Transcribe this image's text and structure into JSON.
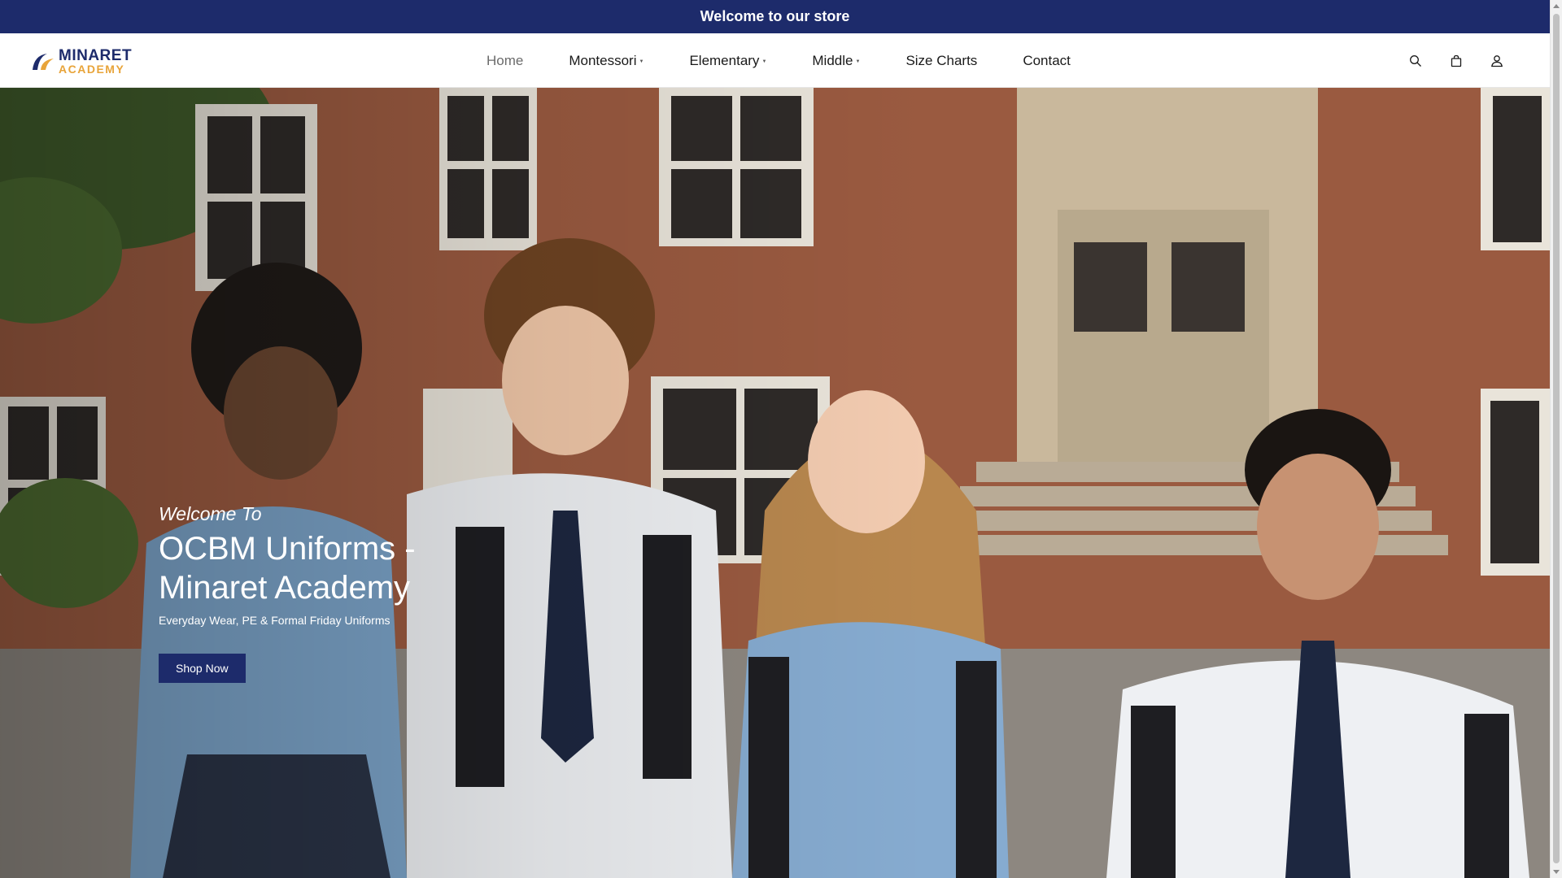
{
  "announcement": {
    "text": "Welcome to our store"
  },
  "header": {
    "logo": {
      "line1": "MINARET",
      "line2": "ACADEMY"
    },
    "nav": [
      {
        "label": "Home",
        "has_dropdown": false,
        "active": true
      },
      {
        "label": "Montessori",
        "has_dropdown": true
      },
      {
        "label": "Elementary",
        "has_dropdown": true
      },
      {
        "label": "Middle",
        "has_dropdown": true
      },
      {
        "label": "Size Charts",
        "has_dropdown": false
      },
      {
        "label": "Contact",
        "has_dropdown": false
      }
    ],
    "icons": [
      "search-icon",
      "cart-icon",
      "account-icon"
    ]
  },
  "hero": {
    "eyebrow": "Welcome To",
    "title": "OCBM Uniforms - Minaret Academy",
    "subtitle": "Everyday Wear, PE & Formal Friday Uniforms",
    "button_label": "Shop Now",
    "image_description": "Four smiling students in school uniforms walking in front of a brick school building"
  },
  "colors": {
    "brand_navy": "#1d2b6b",
    "brand_gold": "#e8a43a",
    "text_dark": "#1a1a1a",
    "nav_active": "#6b6b6b"
  }
}
